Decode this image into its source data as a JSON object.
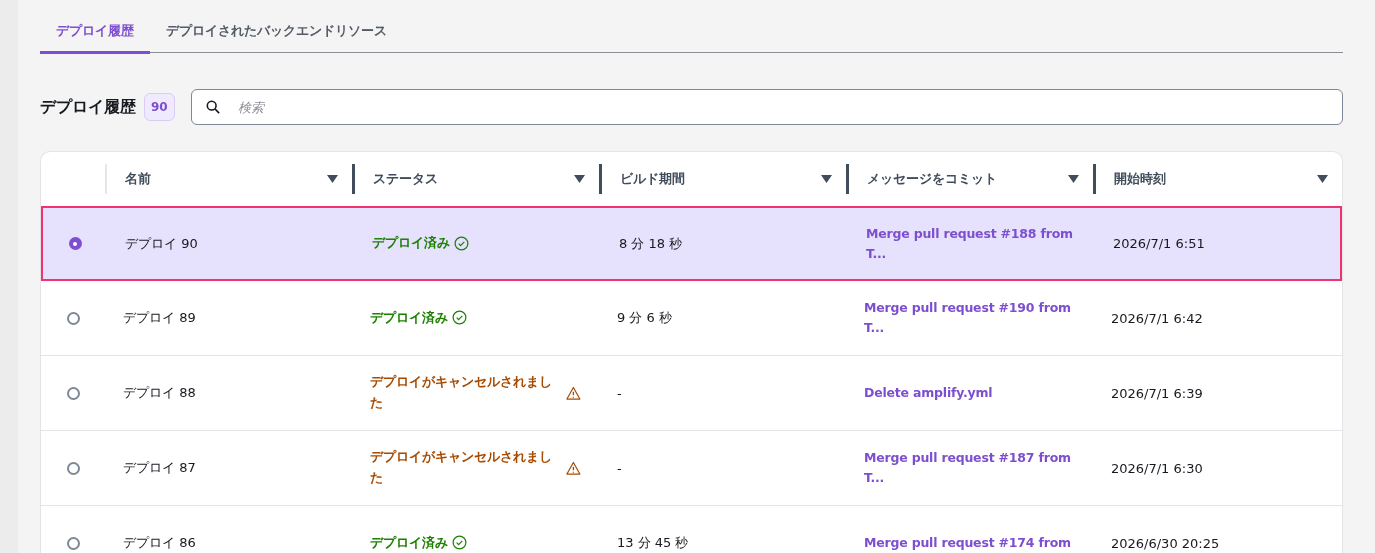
{
  "tabs": [
    {
      "label": "デプロイ履歴",
      "selected": true
    },
    {
      "label": "デプロイされたバックエンドリソース",
      "selected": false
    }
  ],
  "section": {
    "title": "デプロイ履歴",
    "count": "90"
  },
  "search": {
    "placeholder": "検索"
  },
  "table": {
    "columns": [
      "名前",
      "ステータス",
      "ビルド期間",
      "メッセージをコミット",
      "開始時刻"
    ],
    "rows": [
      {
        "selected": true,
        "name": "デプロイ 90",
        "status": {
          "kind": "success",
          "text": "デプロイ済み"
        },
        "duration": "8 分 18 秒",
        "message": "Merge pull request #188 from T...",
        "started": "2026/7/1 6:51"
      },
      {
        "selected": false,
        "name": "デプロイ 89",
        "status": {
          "kind": "success",
          "text": "デプロイ済み"
        },
        "duration": "9 分 6 秒",
        "message": "Merge pull request #190 from T...",
        "started": "2026/7/1 6:42"
      },
      {
        "selected": false,
        "name": "デプロイ 88",
        "status": {
          "kind": "cancelled",
          "text": "デプロイがキャンセルされました"
        },
        "duration": "-",
        "message": "Delete amplify.yml",
        "started": "2026/7/1 6:39"
      },
      {
        "selected": false,
        "name": "デプロイ 87",
        "status": {
          "kind": "cancelled",
          "text": "デプロイがキャンセルされました"
        },
        "duration": "-",
        "message": "Merge pull request #187 from T...",
        "started": "2026/7/1 6:30"
      },
      {
        "selected": false,
        "name": "デプロイ 86",
        "status": {
          "kind": "success",
          "text": "デプロイ済み"
        },
        "duration": "13 分 45 秒",
        "message": "Merge pull request #174 from",
        "started": "2026/6/30 20:25"
      }
    ]
  }
}
